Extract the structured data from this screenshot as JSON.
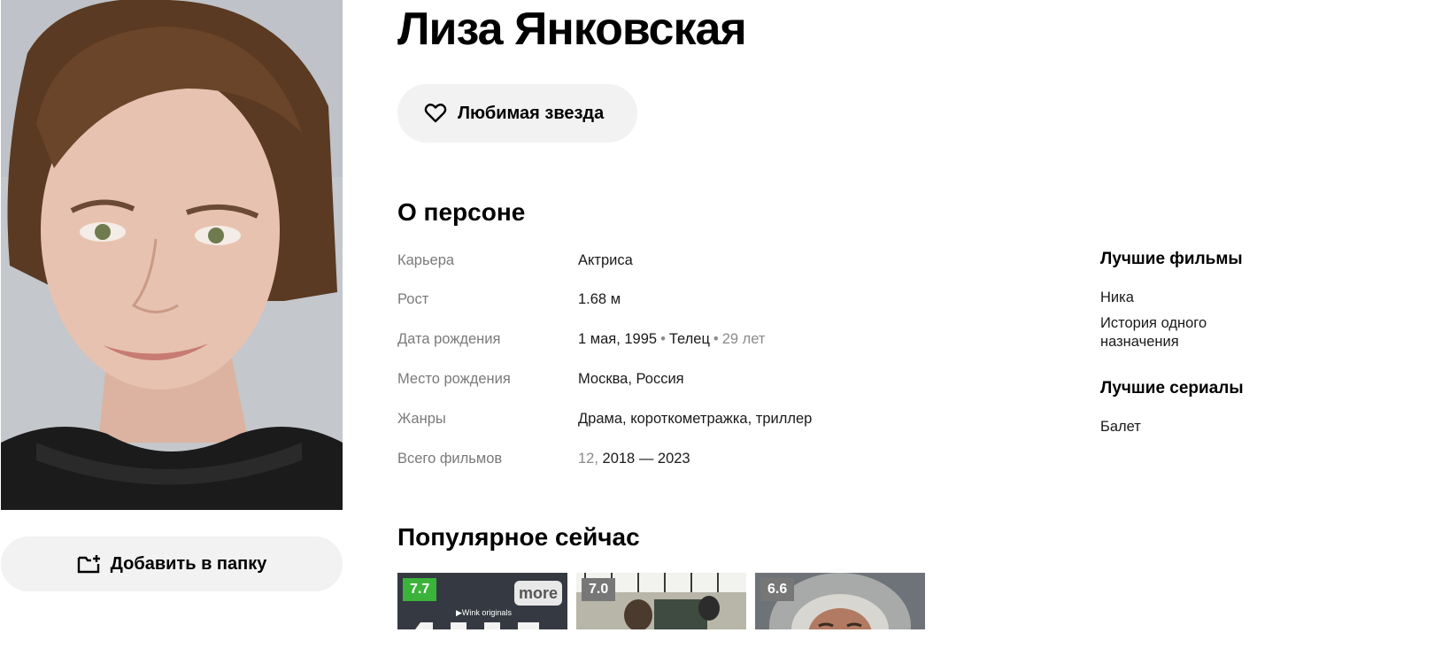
{
  "person": {
    "name": "Лиза Янковская"
  },
  "actions": {
    "favorite_label": "Любимая звезда",
    "add_to_folder_label": "Добавить в папку"
  },
  "about": {
    "title": "О персоне",
    "career_label": "Карьера",
    "career_value": "Актриса",
    "height_label": "Рост",
    "height_value": "1.68 м",
    "birth_date_label": "Дата рождения",
    "birth_date_value": "1 мая, 1995",
    "zodiac": "Телец",
    "age": "29 лет",
    "birth_place_label": "Место рождения",
    "birth_place_value": "Москва, Россия",
    "genres_label": "Жанры",
    "genres_value": "Драма, короткометражка, триллер",
    "films_total_label": "Всего фильмов",
    "films_total_count": "12,",
    "films_total_years": "2018 — 2023"
  },
  "best": {
    "films_title": "Лучшие фильмы",
    "films": [
      "Ника",
      "История одного назначения"
    ],
    "series_title": "Лучшие сериалы",
    "series": [
      "Балет"
    ]
  },
  "popular": {
    "title": "Популярное сейчас",
    "cards": [
      {
        "rating": "7.7",
        "rating_color": "#3bb33b",
        "badge": "more",
        "brand": "▶Wink originals"
      },
      {
        "rating": "7.0",
        "rating_color": "#777777"
      },
      {
        "rating": "6.6",
        "rating_color": "#777777"
      }
    ]
  },
  "icons": {
    "favorite": "heart-icon",
    "folder": "folder-plus-icon"
  }
}
